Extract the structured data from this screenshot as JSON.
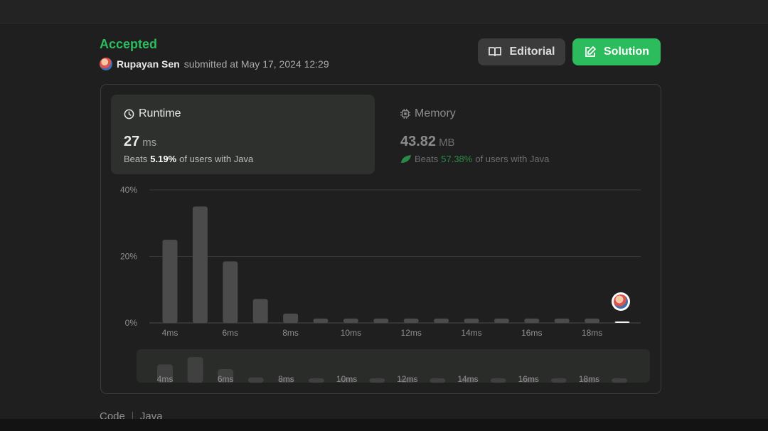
{
  "status": "Accepted",
  "submission": {
    "user": "Rupayan Sen",
    "text": "submitted at May 17, 2024 12:29"
  },
  "buttons": {
    "editorial": "Editorial",
    "solution": "Solution"
  },
  "runtime": {
    "title": "Runtime",
    "value": "27",
    "unit": "ms",
    "beats_prefix": "Beats",
    "beats_value": "5.19%",
    "beats_suffix": "of users with Java"
  },
  "memory": {
    "title": "Memory",
    "value": "43.82",
    "unit": "MB",
    "beats_prefix": "Beats",
    "beats_value": "57.38%",
    "beats_suffix": "of users with Java"
  },
  "colors": {
    "accent_green": "#2cbb5d",
    "bar": "#4a4b4a",
    "grid": "#3a3b3a"
  },
  "chart_data": {
    "type": "bar",
    "ylim": [
      0,
      40
    ],
    "y_ticks": [
      "40%",
      "20%",
      "0%"
    ],
    "x_tick_labels": [
      "4ms",
      "6ms",
      "8ms",
      "10ms",
      "12ms",
      "14ms",
      "16ms",
      "18ms"
    ],
    "categories_ms": [
      4,
      5,
      6,
      7,
      8,
      9,
      10,
      11,
      12,
      13,
      14,
      15,
      16,
      17,
      18,
      19
    ],
    "values": [
      25,
      35,
      18.5,
      7.2,
      2.8,
      1.3,
      1.3,
      1.3,
      1.3,
      1.3,
      1.3,
      1.3,
      1.3,
      1.3,
      1.3,
      0.3
    ],
    "user_runtime_ms": 27,
    "navigator_labels": [
      "4ms",
      "6ms",
      "8ms",
      "10ms",
      "12ms",
      "14ms",
      "16ms",
      "18ms"
    ]
  },
  "code_tabs": {
    "code": "Code",
    "language": "Java"
  }
}
